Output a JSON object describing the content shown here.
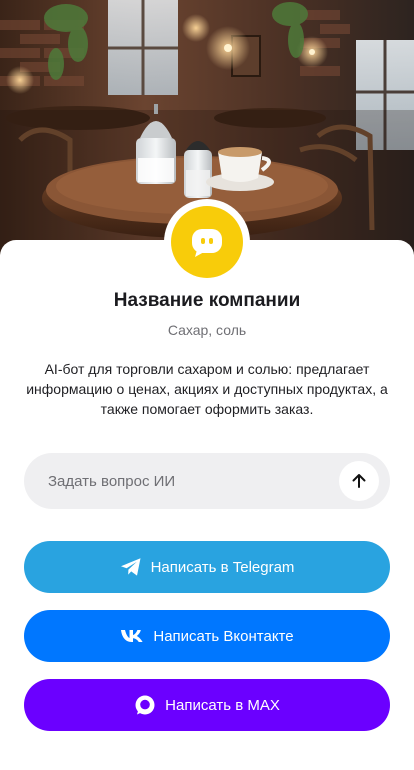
{
  "hero": {
    "description_icon": "cafe-photo"
  },
  "company": {
    "logo_icon": "chat-bubble-icon",
    "name": "Название компании",
    "subtitle": "Сахар, соль",
    "description": "AI-бот для торговли сахаром и солью: предлагает информацию о ценах, акциях и доступных продуктах, а также помогает оформить заказ."
  },
  "ask": {
    "placeholder": "Задать вопрос ИИ",
    "send_icon": "arrow-up-icon"
  },
  "buttons": [
    {
      "label": "Написать в Telegram",
      "icon": "telegram-icon",
      "color": "#29a3e0"
    },
    {
      "label": "Написать Вконтакте",
      "icon": "vk-icon",
      "color": "#0077ff"
    },
    {
      "label": "Написать в MAX",
      "icon": "max-icon",
      "color": "#6b00ff"
    }
  ],
  "colors": {
    "logo_background": "#f8cc0a",
    "input_background": "#efeff1"
  }
}
